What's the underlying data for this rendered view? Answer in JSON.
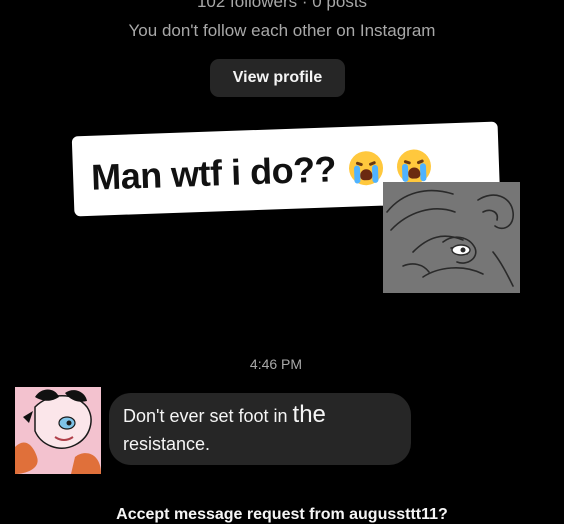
{
  "profile": {
    "stats": "102 followers · 0 posts",
    "follow_status": "You don't follow each other on Instagram",
    "view_profile_label": "View profile"
  },
  "caption": {
    "text": "Man wtf i do??",
    "emoji": [
      "loudly-crying-face",
      "loudly-crying-face"
    ]
  },
  "conversation": {
    "timestamp": "4:46 PM",
    "message": {
      "part1": "Don't ever set foot in ",
      "part2": "the",
      "part3": "resistance",
      "part4": "."
    }
  },
  "request": {
    "prompt": "Accept message request from augussttt11?"
  },
  "colors": {
    "background": "#000000",
    "bubble": "#262626",
    "button": "#262626",
    "secondary_text": "#a8a8a8",
    "sticker": "#ffffff"
  }
}
